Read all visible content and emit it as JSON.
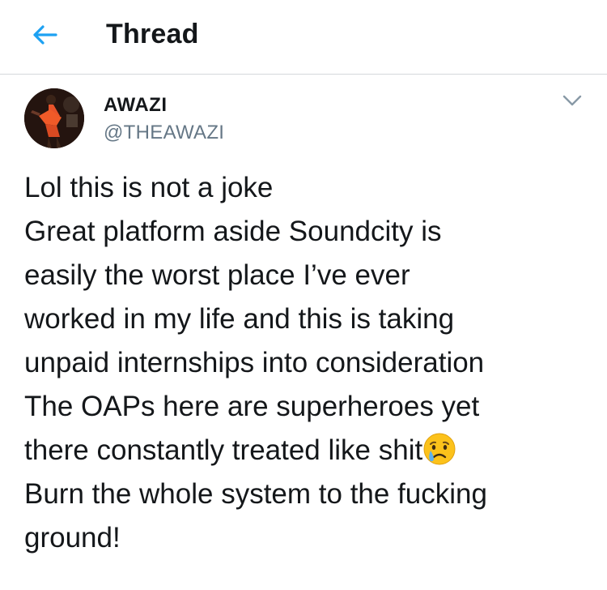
{
  "header": {
    "title": "Thread",
    "back_icon": "arrow-left-icon",
    "accent_color": "#1da1f2"
  },
  "tweet": {
    "author_name": "AWAZI",
    "author_handle": "@THEAWAZI",
    "menu_icon": "chevron-down-icon",
    "lines": [
      "Lol this is not a joke",
      "Great platform aside Soundcity is",
      "easily the worst place I’ve ever",
      "worked in my life and this is taking",
      "unpaid internships into consideration",
      "The OAPs here are superheroes yet",
      "there constantly treated like shit",
      "Burn the whole system to the fucking",
      "ground!"
    ],
    "emoji_icon": "crying-face-emoji"
  }
}
